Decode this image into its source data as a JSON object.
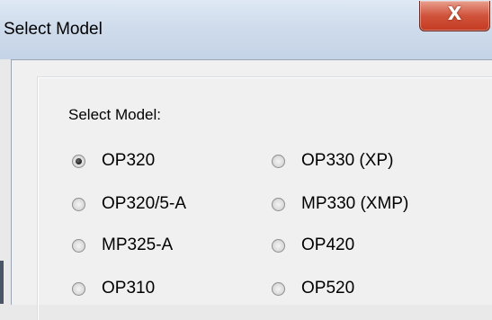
{
  "window": {
    "title": "Select Model",
    "close_glyph": "X"
  },
  "group": {
    "label": "Select Model:"
  },
  "options": [
    {
      "label": "OP320",
      "checked": true
    },
    {
      "label": "OP330 (XP)",
      "checked": false
    },
    {
      "label": "OP320/5-A",
      "checked": false
    },
    {
      "label": "MP330 (XMP)",
      "checked": false
    },
    {
      "label": "MP325-A",
      "checked": false
    },
    {
      "label": "OP420",
      "checked": false
    },
    {
      "label": "OP310",
      "checked": false
    },
    {
      "label": "OP520",
      "checked": false
    }
  ]
}
